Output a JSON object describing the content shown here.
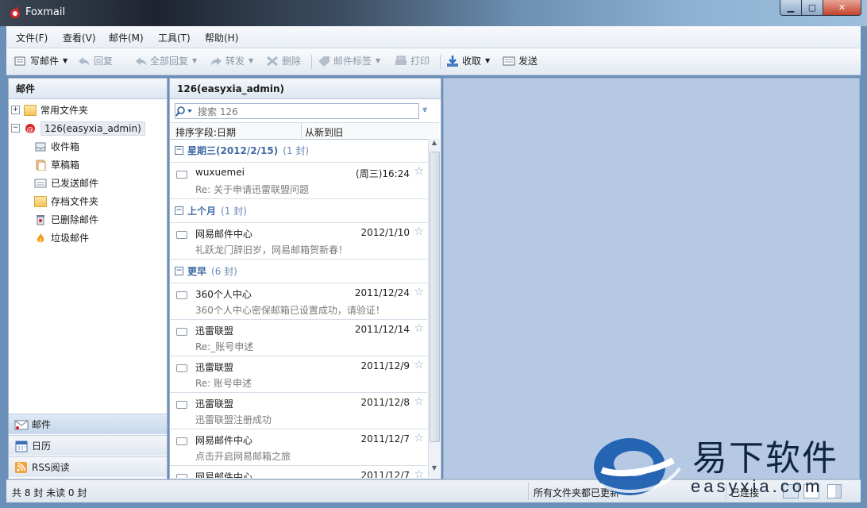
{
  "window": {
    "title": "Foxmail"
  },
  "menu": [
    "文件(F)",
    "查看(V)",
    "邮件(M)",
    "工具(T)",
    "帮助(H)"
  ],
  "toolbar": {
    "compose": "写邮件",
    "reply": "回复",
    "reply_all": "全部回复",
    "forward": "转发",
    "delete": "删除",
    "tag": "邮件标签",
    "print": "打印",
    "receive": "收取",
    "send": "发送"
  },
  "left_pane": {
    "header": "邮件",
    "tree": [
      {
        "label": "常用文件夹",
        "icon": "folder-icon"
      },
      {
        "label": "126(easyxia_admin)",
        "icon": "account-icon"
      },
      {
        "label": "收件箱",
        "icon": "inbox-icon"
      },
      {
        "label": "草稿箱",
        "icon": "drafts-icon"
      },
      {
        "label": "已发送邮件",
        "icon": "sent-icon"
      },
      {
        "label": "存档文件夹",
        "icon": "folder-icon"
      },
      {
        "label": "已删除邮件",
        "icon": "trash-icon"
      },
      {
        "label": "垃圾邮件",
        "icon": "spam-icon"
      }
    ],
    "nav": [
      {
        "label": "邮件",
        "icon": "mail-icon"
      },
      {
        "label": "日历",
        "icon": "calendar-icon"
      },
      {
        "label": "RSS阅读",
        "icon": "rss-icon"
      }
    ]
  },
  "mid_pane": {
    "header": "126(easyxia_admin)",
    "search_placeholder": "搜索 126",
    "sort_field": "排序字段:日期",
    "sort_order": "从新到旧",
    "groups": [
      {
        "title": "星期三(2012/2/15)",
        "count": "(1 封)",
        "mails": [
          {
            "from": "wuxuemei",
            "date": "(周三)16:24",
            "subject": "Re: 关于申请迅雷联盟问题"
          }
        ]
      },
      {
        "title": "上个月",
        "count": "(1 封)",
        "mails": [
          {
            "from": "网易邮件中心",
            "date": "2012/1/10",
            "subject": "礼跃龙门辞旧岁，网易邮箱贺新春！"
          }
        ]
      },
      {
        "title": "更早",
        "count": "(6 封)",
        "mails": [
          {
            "from": "360个人中心",
            "date": "2011/12/24",
            "subject": "360个人中心密保邮箱已设置成功，请验证！"
          },
          {
            "from": "迅雷联盟",
            "date": "2011/12/14",
            "subject": "Re:_账号申述"
          },
          {
            "from": "迅雷联盟",
            "date": "2011/12/9",
            "subject": "Re: 账号申述"
          },
          {
            "from": "迅雷联盟",
            "date": "2011/12/8",
            "subject": "迅雷联盟注册成功"
          },
          {
            "from": "网易邮件中心",
            "date": "2011/12/7",
            "subject": "点击开启网易邮箱之旅"
          },
          {
            "from": "网易邮件中心",
            "date": "2011/12/7",
            "subject": ""
          }
        ]
      }
    ]
  },
  "status": {
    "counts": "共 8 封 未读 0 封",
    "update": "所有文件夹都已更新",
    "conn": "已连接"
  },
  "watermark": {
    "brand": "易下软件",
    "site": "easyxia.com"
  }
}
